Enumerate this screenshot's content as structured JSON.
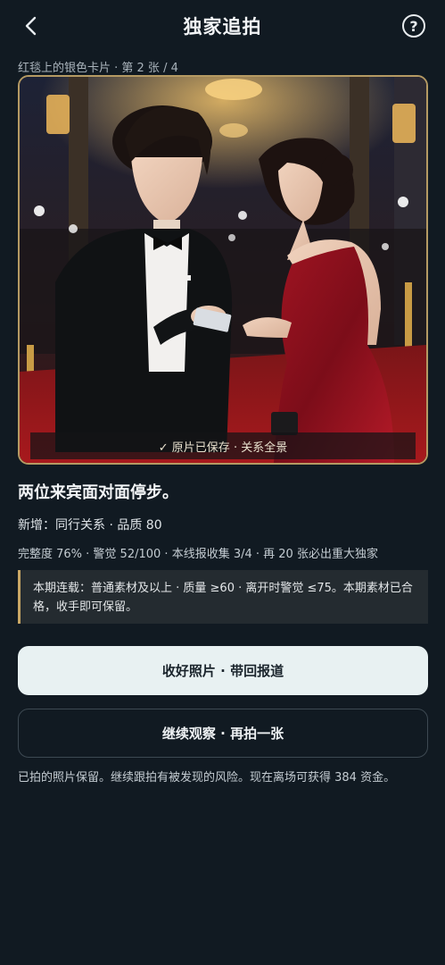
{
  "header": {
    "title": "独家追拍",
    "back_icon": "chevron-left-icon",
    "help_label": "?",
    "help_icon": "question-circle-icon"
  },
  "photo": {
    "caption": "红毯上的银色卡片 · 第 2 张 / 4",
    "saved_label": "✓ 原片已保存 · 关系全景",
    "frame_color": "#b59a63"
  },
  "result": {
    "headline": "两位来宾面对面停步。",
    "new_item": "新增：同行关系 · 品质 80",
    "progress": "完整度 76% · 警觉 52/100 · 本线报收集 3/4 · 再 20 张必出重大独家"
  },
  "notice": {
    "text": "本期连载：普通素材及以上 · 质量 ≥60 · 离开时警觉 ≤75。本期素材已合格，收手即可保留。",
    "accent_color": "#c9a765"
  },
  "actions": {
    "primary_label": "收好照片 · 带回报道",
    "secondary_label": "继续观察 · 再拍一张"
  },
  "footer": {
    "note": "已拍的照片保留。继续跟拍有被发现的风险。现在离场可获得 384 资金。"
  }
}
